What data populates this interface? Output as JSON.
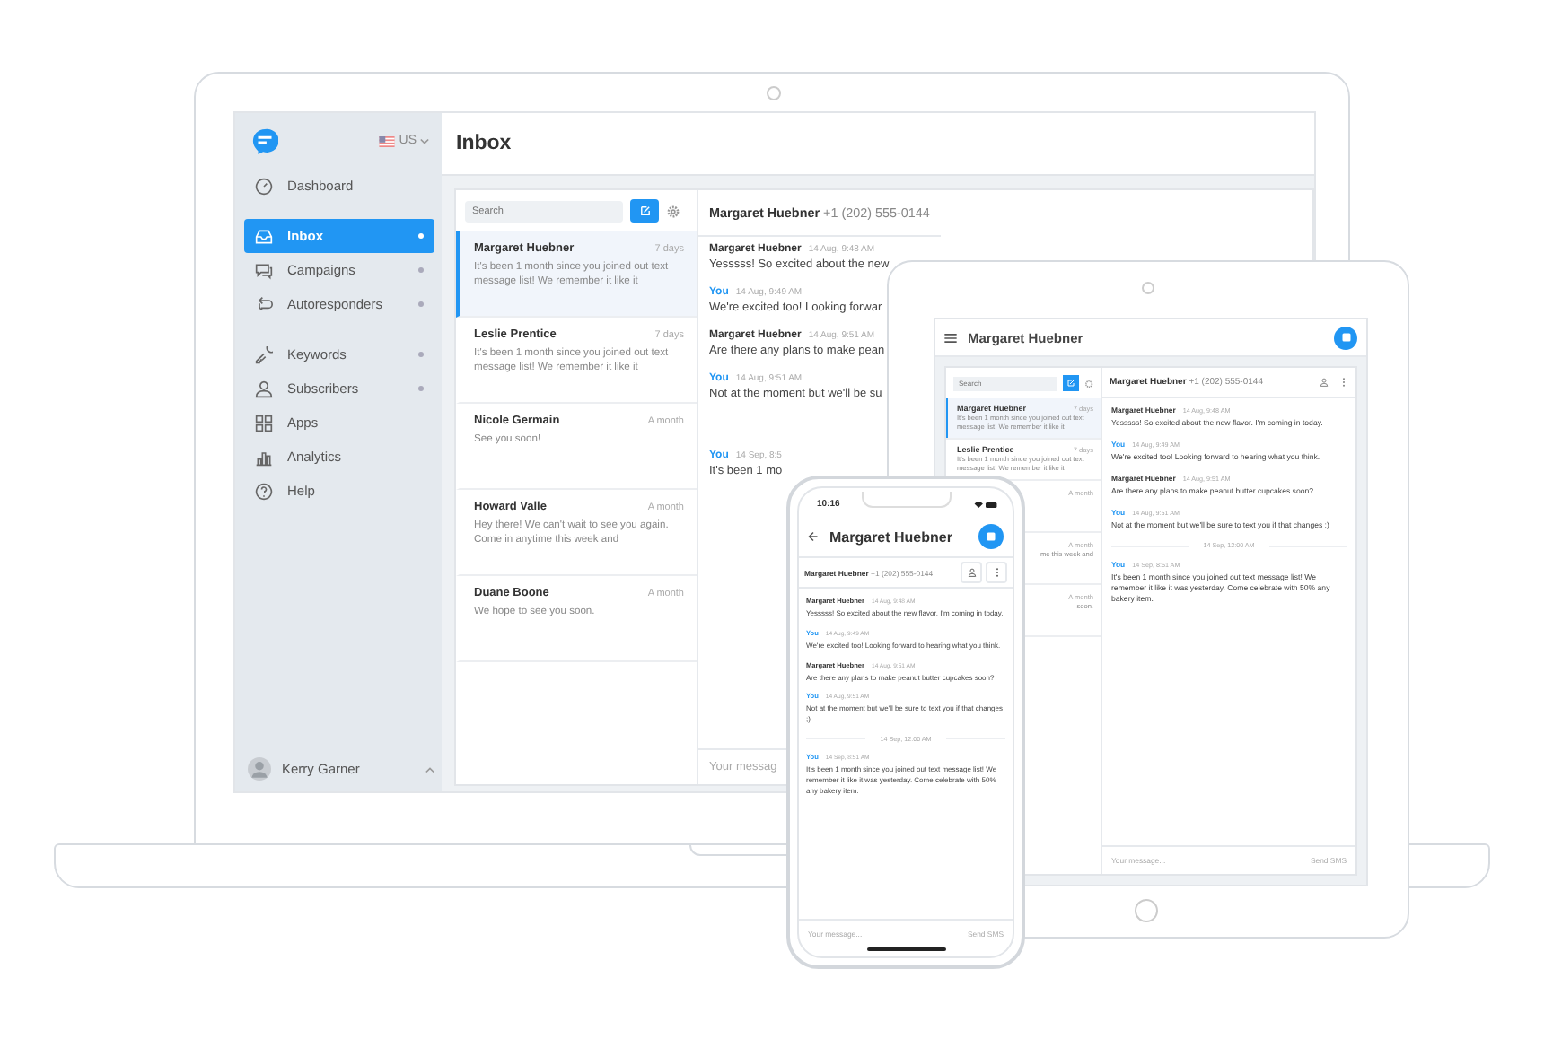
{
  "laptop": {
    "sidebar": {
      "country": "US",
      "nav": [
        {
          "label": "Dashboard",
          "selected": false,
          "has_submenu": false
        },
        {
          "label": "Inbox",
          "selected": true,
          "has_submenu": true
        },
        {
          "label": "Campaigns",
          "selected": false,
          "has_submenu": true
        },
        {
          "label": "Autoresponders",
          "selected": false,
          "has_submenu": true
        },
        {
          "label": "Keywords",
          "selected": false,
          "has_submenu": true
        },
        {
          "label": "Subscribers",
          "selected": false,
          "has_submenu": true
        },
        {
          "label": "Apps",
          "selected": false,
          "has_submenu": false
        },
        {
          "label": "Analytics",
          "selected": false,
          "has_submenu": false
        },
        {
          "label": "Help",
          "selected": false,
          "has_submenu": false
        }
      ],
      "user": {
        "name": "Kerry Garner"
      }
    },
    "page_title": "Inbox",
    "search": {
      "placeholder": "Search"
    },
    "conversations": [
      {
        "name": "Margaret Huebner",
        "time": "7 days",
        "preview": "It's been 1 month since you joined out text message list! We remember it like it",
        "selected": true
      },
      {
        "name": "Leslie Prentice",
        "time": "7 days",
        "preview": "It's been 1 month since you joined out text message list! We remember it like it",
        "selected": false
      },
      {
        "name": "Nicole Germain",
        "time": "A month",
        "preview": "See you soon!",
        "selected": false
      },
      {
        "name": "Howard Valle",
        "time": "A month",
        "preview": "Hey there! We can't wait to see you again. Come in anytime this week and",
        "selected": false
      },
      {
        "name": "Duane Boone",
        "time": "A month",
        "preview": "We hope to see you soon.",
        "selected": false
      }
    ],
    "thread": {
      "contact": "Margaret Huebner",
      "phone": "+1 (202) 555-0144",
      "messages": [
        {
          "kind": "contact",
          "sender": "Margaret Huebner",
          "time": "14 Aug, 9:48 AM",
          "text": "Yesssss! So excited about the new"
        },
        {
          "kind": "you",
          "sender": "You",
          "time": "14 Aug, 9:49 AM",
          "text": "We're excited too! Looking forwar"
        },
        {
          "kind": "contact",
          "sender": "Margaret Huebner",
          "time": "14 Aug, 9:51 AM",
          "text": "Are there any plans to make pean"
        },
        {
          "kind": "you",
          "sender": "You",
          "time": "14 Aug, 9:51 AM",
          "text": "Not at the moment but we'll be su"
        },
        {
          "kind": "you",
          "sender": "You",
          "time": "14 Sep, 8:5",
          "text": "It's been 1 mo"
        }
      ],
      "composer_placeholder": "Your messag"
    }
  },
  "tablet": {
    "title": "Margaret Huebner",
    "search": {
      "placeholder": "Search"
    },
    "conversations": [
      {
        "name": "Margaret Huebner",
        "time": "7 days",
        "preview": "It's been 1 month since you joined out text message list! We remember it like it",
        "selected": true
      },
      {
        "name": "Leslie Prentice",
        "time": "7 days",
        "preview": "It's been 1 month since you joined out text message list! We remember it like it",
        "selected": false
      },
      {
        "time": "A month",
        "selected": false
      },
      {
        "time": "A month",
        "preview": "me this week and",
        "selected": false
      },
      {
        "time": "A month",
        "preview": "soon.",
        "selected": false
      }
    ],
    "thread": {
      "contact": "Margaret Huebner",
      "phone": "+1 (202) 555-0144",
      "messages": [
        {
          "kind": "contact",
          "sender": "Margaret Huebner",
          "time": "14 Aug, 9:48 AM",
          "text": "Yesssss! So excited about the new flavor. I'm coming in today."
        },
        {
          "kind": "you",
          "sender": "You",
          "time": "14 Aug, 9:49 AM",
          "text": "We're excited too! Looking forward to hearing what you think."
        },
        {
          "kind": "contact",
          "sender": "Margaret Huebner",
          "time": "14 Aug, 9:51 AM",
          "text": "Are there any plans to make peanut butter cupcakes soon?"
        },
        {
          "kind": "you",
          "sender": "You",
          "time": "14 Aug, 9:51 AM",
          "text": "Not at the moment but we'll be sure to text you if that changes ;)"
        },
        {
          "kind": "divider",
          "text": "14 Sep, 12:00 AM"
        },
        {
          "kind": "you",
          "sender": "You",
          "time": "14 Sep, 8:51 AM",
          "text": "It's been 1 month since you joined out text message list! We remember it like it was yesterday. Come celebrate with 50% any bakery item."
        }
      ],
      "composer_placeholder": "Your message...",
      "send_label": "Send SMS"
    }
  },
  "phone": {
    "clock": "10:16",
    "title": "Margaret Huebner",
    "contact": "Margaret Huebner",
    "phone": "+1 (202) 555-0144",
    "messages": [
      {
        "kind": "contact",
        "sender": "Margaret Huebner",
        "time": "14 Aug, 9:48 AM",
        "text": "Yesssss! So excited about the new flavor. I'm coming in today."
      },
      {
        "kind": "you",
        "sender": "You",
        "time": "14 Aug, 9:49 AM",
        "text": "We're excited too! Looking forward to hearing what you think."
      },
      {
        "kind": "contact",
        "sender": "Margaret Huebner",
        "time": "14 Aug, 9:51 AM",
        "text": "Are there any plans to make peanut butter cupcakes soon?"
      },
      {
        "kind": "you",
        "sender": "You",
        "time": "14 Aug, 9:51 AM",
        "text": "Not at the moment but we'll be sure to text you if that changes ;)"
      },
      {
        "kind": "divider",
        "text": "14 Sep, 12:00 AM"
      },
      {
        "kind": "you",
        "sender": "You",
        "time": "14 Sep, 8:51 AM",
        "text": "It's been 1 month since you joined out text message list! We remember it like it was yesterday. Come celebrate with 50% any bakery item."
      }
    ],
    "composer_placeholder": "Your message...",
    "send_label": "Send SMS"
  }
}
